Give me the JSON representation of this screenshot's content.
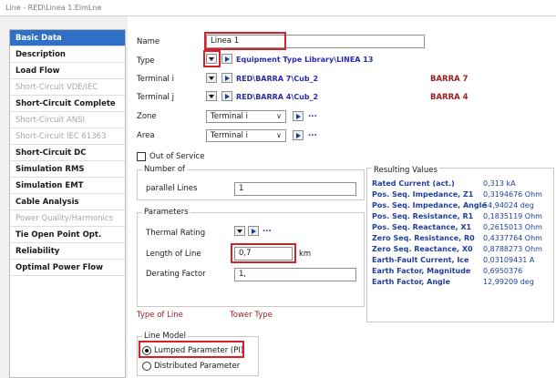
{
  "window": {
    "title": "Line - RED\\Linea 1.ElmLne"
  },
  "sidebar": {
    "items": [
      {
        "label": "Basic Data",
        "state": "selected"
      },
      {
        "label": "Description",
        "state": "normal"
      },
      {
        "label": "Load Flow",
        "state": "normal"
      },
      {
        "label": "Short-Circuit VDE/IEC",
        "state": "disabled"
      },
      {
        "label": "Short-Circuit Complete",
        "state": "normal"
      },
      {
        "label": "Short-Circuit ANSI",
        "state": "disabled"
      },
      {
        "label": "Short-Circuit IEC 61363",
        "state": "disabled"
      },
      {
        "label": "Short-Circuit DC",
        "state": "normal"
      },
      {
        "label": "Simulation RMS",
        "state": "normal"
      },
      {
        "label": "Simulation EMT",
        "state": "normal"
      },
      {
        "label": "Cable Analysis",
        "state": "normal"
      },
      {
        "label": "Power Quality/Harmonics",
        "state": "disabled"
      },
      {
        "label": "Tie Open Point Opt.",
        "state": "normal"
      },
      {
        "label": "Reliability",
        "state": "normal"
      },
      {
        "label": "Optimal Power Flow",
        "state": "normal"
      }
    ]
  },
  "form": {
    "name_label": "Name",
    "name_value": "Linea 1",
    "type_label": "Type",
    "type_link": "Equipment Type Library\\LINEA 13",
    "terminal_i_label": "Terminal i",
    "terminal_i_link": "RED\\BARRA 7\\Cub_2",
    "terminal_i_bus": "BARRA 7",
    "terminal_j_label": "Terminal j",
    "terminal_j_link": "RED\\BARRA 4\\Cub_2",
    "terminal_j_bus": "BARRA 4",
    "zone_label": "Zone",
    "zone_value": "Terminal i",
    "area_label": "Area",
    "area_value": "Terminal i",
    "dots": "...",
    "out_of_service_label": "Out of Service",
    "number_of_label": "Number of",
    "parallel_lines_label": "parallel Lines",
    "parallel_lines_value": "1",
    "parameters_label": "Parameters",
    "thermal_rating_label": "Thermal Rating",
    "length_label": "Length of Line",
    "length_value": "0,7",
    "length_unit": "km",
    "derating_label": "Derating Factor",
    "derating_value": "1,",
    "type_of_line_label": "Type of Line",
    "tower_type_label": "Tower Type",
    "line_model_label": "Line Model",
    "lumped_label": "Lumped Parameter (PI)",
    "distributed_label": "Distributed Parameter"
  },
  "results": {
    "title": "Resulting Values",
    "rows": [
      {
        "name": "Rated Current (act.)",
        "value": "0,313 kA"
      },
      {
        "name": "Pos. Seq. Impedance, Z1",
        "value": "0,3194676 Ohm"
      },
      {
        "name": "Pos. Seq. Impedance, Angle",
        "value": "54,94024 deg"
      },
      {
        "name": "Pos. Seq. Resistance, R1",
        "value": "0,1835119 Ohm"
      },
      {
        "name": "Pos. Seq. Reactance, X1",
        "value": "0,2615013 Ohm"
      },
      {
        "name": "Zero Seq. Resistance, R0",
        "value": "0,4337764 Ohm"
      },
      {
        "name": "Zero Seq. Reactance, X0",
        "value": "0,8788273 Ohm"
      },
      {
        "name": "Earth-Fault Current, Ice",
        "value": "0,03109431 A"
      },
      {
        "name": "Earth Factor, Magnitude",
        "value": "0,6950376"
      },
      {
        "name": "Earth Factor, Angle",
        "value": "12,99209 deg"
      }
    ]
  },
  "colors": {
    "selected": "#2f6fc5",
    "highlight": "#d8202a",
    "link": "#2a2aa8",
    "bus": "#9c1b1b"
  }
}
